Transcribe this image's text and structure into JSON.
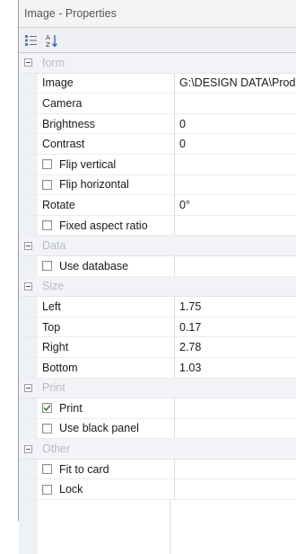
{
  "window": {
    "title": "Image - Properties"
  },
  "toolbar": {
    "categorized_icon": "categorized-icon",
    "sort_icon": "sort-az-icon"
  },
  "sections": {
    "form": {
      "label": "form",
      "image_label": "Image",
      "image_value": "G:\\DESIGN DATA\\Prod",
      "camera_label": "Camera",
      "camera_value": "",
      "brightness_label": "Brightness",
      "brightness_value": "0",
      "contrast_label": "Contrast",
      "contrast_value": "0",
      "flip_vertical_label": "Flip vertical",
      "flip_vertical_checked": false,
      "flip_horizontal_label": "Flip horizontal",
      "flip_horizontal_checked": false,
      "rotate_label": "Rotate",
      "rotate_value": "0°",
      "fixed_aspect_label": "Fixed aspect ratio",
      "fixed_aspect_checked": false
    },
    "data": {
      "label": "Data",
      "use_database_label": "Use database",
      "use_database_checked": false
    },
    "size": {
      "label": "Size",
      "left_label": "Left",
      "left_value": "1.75",
      "top_label": "Top",
      "top_value": "0.17",
      "right_label": "Right",
      "right_value": "2.78",
      "bottom_label": "Bottom",
      "bottom_value": "1.03"
    },
    "print": {
      "label": "Print",
      "print_label": "Print",
      "print_checked": true,
      "black_panel_label": "Use black panel",
      "black_panel_checked": false
    },
    "other": {
      "label": "Other",
      "fit_to_card_label": "Fit to card",
      "fit_to_card_checked": false,
      "lock_label": "Lock",
      "lock_checked": false
    }
  },
  "colors": {
    "category_text": "#b9bcc3",
    "gutter": "#eef1f5",
    "check": "#3a7a2a"
  }
}
